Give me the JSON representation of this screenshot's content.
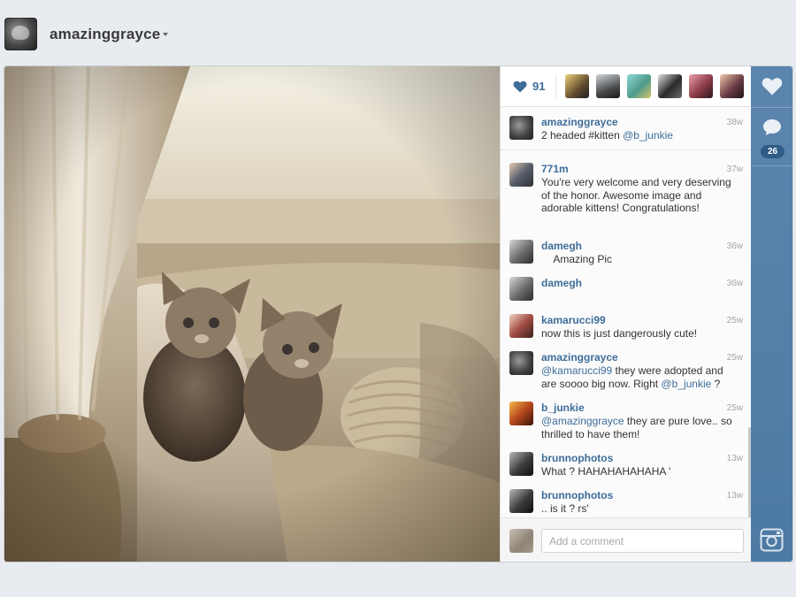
{
  "header": {
    "username": "amazinggrayce",
    "avatar_icon": "profile-avatar"
  },
  "post": {
    "likes": {
      "count": "91",
      "icon": "heart-icon",
      "liker_count_visible": 7
    },
    "comments": [
      {
        "user": "amazinggrayce",
        "time": "38w",
        "parts": [
          {
            "t": "2 headed #kitten "
          },
          {
            "m": "@b_junkie"
          }
        ]
      },
      {
        "user": "771m",
        "time": "37w",
        "parts": [
          {
            "t": "You're very welcome and very deserving of the honor. Awesome image and adorable kittens! Congratulations!"
          }
        ]
      },
      {
        "user": "damegh",
        "time": "36w",
        "parts": [
          {
            "t": "    Amazing Pic"
          }
        ]
      },
      {
        "user": "damegh",
        "time": "36w",
        "parts": [
          {
            "t": ""
          }
        ]
      },
      {
        "user": "kamarucci99",
        "time": "25w",
        "parts": [
          {
            "t": "now this is just dangerously cute!"
          }
        ]
      },
      {
        "user": "amazinggrayce",
        "time": "25w",
        "parts": [
          {
            "m": "@kamarucci99"
          },
          {
            "t": " they were adopted and are soooo big now. Right "
          },
          {
            "m": "@b_junkie"
          },
          {
            "t": " ?"
          }
        ]
      },
      {
        "user": "b_junkie",
        "time": "25w",
        "parts": [
          {
            "m": "@amazinggrayce"
          },
          {
            "t": " they are pure love.. so thrilled to have them!"
          }
        ]
      },
      {
        "user": "brunnophotos",
        "time": "13w",
        "parts": [
          {
            "t": "What ? HAHAHAHAHAHA '"
          }
        ]
      },
      {
        "user": "brunnophotos",
        "time": "13w",
        "parts": [
          {
            "t": ".. is it ? rs'"
          }
        ]
      }
    ],
    "comment_input": {
      "placeholder": "Add a comment",
      "value": ""
    }
  },
  "rail": {
    "like_icon": "heart-icon",
    "comment_icon": "comment-bubble-icon",
    "comment_count": "26",
    "camera_icon": "instagram-camera-icon"
  },
  "colors": {
    "link": "#3e6d99",
    "rail": "#5b85ad",
    "rail_badge": "#2f5b86",
    "timestamp": "#a4a4a4"
  }
}
